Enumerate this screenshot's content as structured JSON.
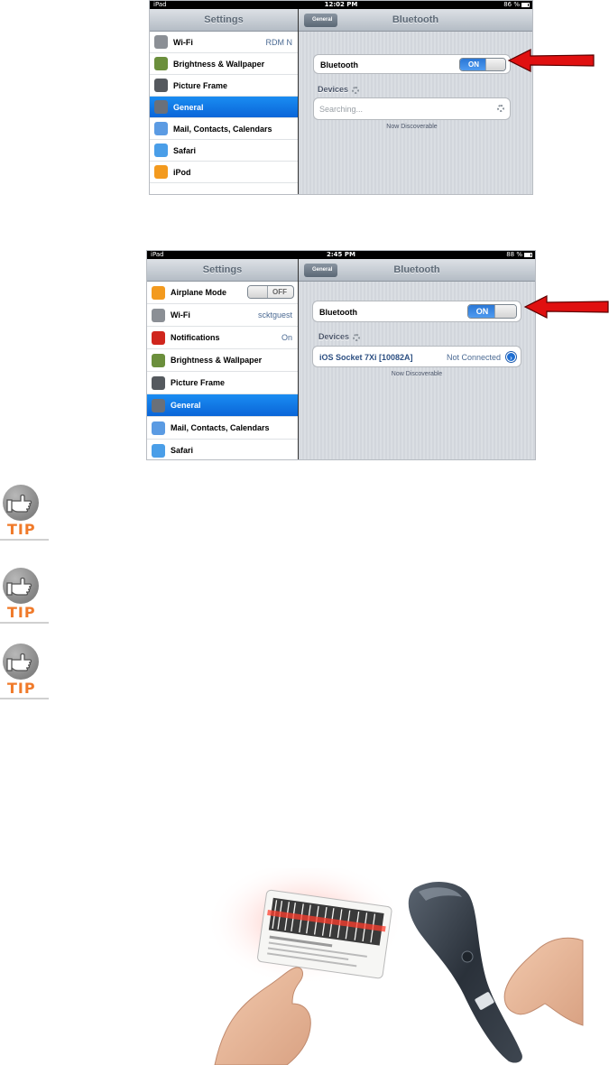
{
  "screenshot1": {
    "status": {
      "left": "iPad",
      "time": "12:02 PM",
      "right": "86 %"
    },
    "sidebar_title": "Settings",
    "rows": [
      {
        "label": "Wi-Fi",
        "value": "RDM N",
        "icon": "wifi-icon",
        "color": "#8b8f95"
      },
      {
        "label": "Brightness & Wallpaper",
        "value": "",
        "icon": "flower-icon",
        "color": "#6b8f3c"
      },
      {
        "label": "Picture Frame",
        "value": "",
        "icon": "picture-frame-icon",
        "color": "#55595e"
      },
      {
        "label": "General",
        "value": "",
        "icon": "gear-icon",
        "color": "#6a7079",
        "selected": true
      },
      {
        "label": "Mail, Contacts, Calendars",
        "value": "",
        "icon": "envelope-icon",
        "color": "#5b9be3"
      },
      {
        "label": "Safari",
        "value": "",
        "icon": "compass-icon",
        "color": "#4a9ee8"
      },
      {
        "label": "iPod",
        "value": "",
        "icon": "ipod-icon",
        "color": "#f39a1e"
      }
    ],
    "detail": {
      "back": "General",
      "title": "Bluetooth",
      "bluetooth_label": "Bluetooth",
      "toggle": "ON",
      "devices_label": "Devices",
      "searching": "Searching...",
      "discoverable": "Now Discoverable"
    }
  },
  "screenshot2": {
    "status": {
      "left": "iPad",
      "time": "2:45 PM",
      "right": "88 %"
    },
    "sidebar_title": "Settings",
    "rows": [
      {
        "label": "Airplane Mode",
        "value": "",
        "toggle": "OFF",
        "icon": "airplane-icon",
        "color": "#f39a1e"
      },
      {
        "label": "Wi-Fi",
        "value": "scktguest",
        "icon": "wifi-icon",
        "color": "#8b8f95"
      },
      {
        "label": "Notifications",
        "value": "On",
        "icon": "notifications-icon",
        "color": "#d0261d"
      },
      {
        "label": "Brightness & Wallpaper",
        "value": "",
        "icon": "flower-icon",
        "color": "#6b8f3c"
      },
      {
        "label": "Picture Frame",
        "value": "",
        "icon": "picture-frame-icon",
        "color": "#55595e"
      },
      {
        "label": "General",
        "value": "",
        "icon": "gear-icon",
        "color": "#6a7079",
        "selected": true
      },
      {
        "label": "Mail, Contacts, Calendars",
        "value": "",
        "icon": "envelope-icon",
        "color": "#5b9be3"
      },
      {
        "label": "Safari",
        "value": "",
        "icon": "compass-icon",
        "color": "#4a9ee8"
      }
    ],
    "detail": {
      "back": "General",
      "title": "Bluetooth",
      "bluetooth_label": "Bluetooth",
      "toggle": "ON",
      "devices_label": "Devices",
      "device_name": "iOS Socket 7Xi [10082A]",
      "device_status": "Not Connected",
      "discoverable": "Now Discoverable"
    }
  },
  "tips": [
    {
      "label": "TIP"
    },
    {
      "label": "TIP"
    },
    {
      "label": "TIP"
    }
  ],
  "colors": {
    "arrow": "#e01010",
    "tip_text": "#f07a2a",
    "selected_row": "#0a65d8",
    "toggle_on": "#2a77d6"
  }
}
